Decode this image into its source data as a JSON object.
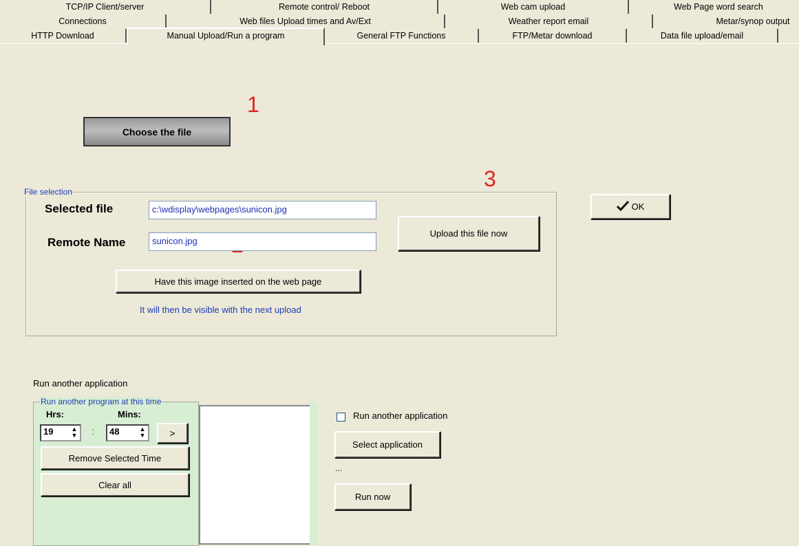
{
  "tabs": {
    "row1": [
      "TCP/IP Client/server",
      "Remote control/ Reboot",
      "Web cam upload",
      "Web Page word search"
    ],
    "row2": [
      "Connections",
      "Web files Upload times and  Av/Ext",
      "Weather report email",
      "Metar/synop output"
    ],
    "row3": [
      "HTTP Download",
      "Manual Upload/Run a program",
      "General FTP Functions",
      "FTP/Metar download",
      "Data file upload/email"
    ]
  },
  "annotations": {
    "one": "1",
    "two": "2",
    "three": "3"
  },
  "buttons": {
    "choose_file": "Choose the file",
    "ok": "OK",
    "upload_now": "Upload this file now",
    "insert_image": "Have this image inserted on the web page",
    "next_time": ">",
    "remove_time": "Remove Selected Time",
    "clear_all": "Clear all",
    "select_app": "Select application",
    "run_now": "Run now"
  },
  "file_selection": {
    "legend": "File selection",
    "selected_label": "Selected file",
    "selected_value": "c:\\wdisplay\\webpages\\sunicon.jpg",
    "remote_label": "Remote Name",
    "remote_value": "sunicon.jpg",
    "note": "It will then be visible with the next upload"
  },
  "run_app": {
    "title": "Run another application",
    "group_legend": "Run another program at this time",
    "hrs_label": "Hrs:",
    "mins_label": "Mins:",
    "hrs_value": "19",
    "mins_value": "48",
    "colon": ":",
    "checkbox_label": "Run another application",
    "checkbox_checked": false,
    "ellipsis": "..."
  }
}
